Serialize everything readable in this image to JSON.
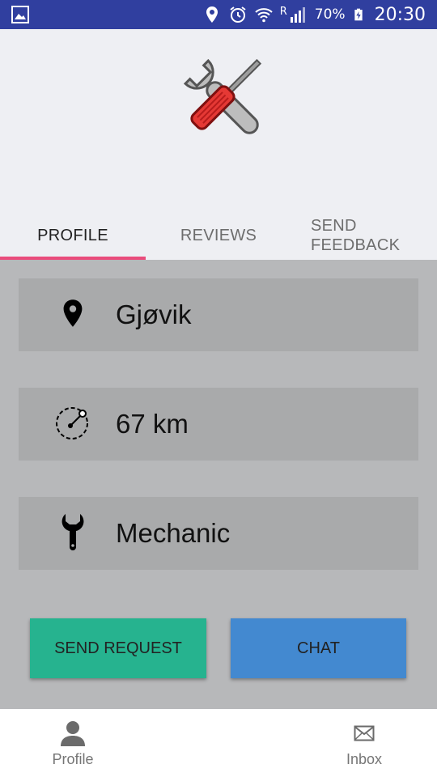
{
  "status_bar": {
    "battery": "70%",
    "time": "20:30",
    "network": "R",
    "icons": [
      "gallery-icon",
      "location-icon",
      "alarm-icon",
      "wifi-icon",
      "signal-icon",
      "battery-charging-icon"
    ]
  },
  "header": {
    "logo_icon": "tools-icon"
  },
  "tabs": [
    {
      "label": "PROFILE",
      "selected": true
    },
    {
      "label": "REVIEWS",
      "selected": false
    },
    {
      "label": "SEND FEEDBACK",
      "selected": false
    }
  ],
  "info": {
    "location": {
      "icon": "location-pin-icon",
      "text": "Gjøvik"
    },
    "distance": {
      "icon": "distance-radius-icon",
      "text": "67 km"
    },
    "profession": {
      "icon": "wrench-icon",
      "text": "Mechanic"
    }
  },
  "actions": {
    "send_request": "SEND REQUEST",
    "chat": "CHAT"
  },
  "bottom_nav": {
    "profile": {
      "icon": "person-icon",
      "label": "Profile"
    },
    "inbox": {
      "icon": "mail-icon",
      "label": "Inbox"
    }
  },
  "colors": {
    "status_bar": "#303f9f",
    "header_bg": "#eeeff3",
    "tab_indicator": "#e94c7c",
    "content_bg": "#b7b8ba",
    "row_bg": "#a9aaab",
    "send_request_button": "#26b38f",
    "chat_button": "#4389d0"
  }
}
